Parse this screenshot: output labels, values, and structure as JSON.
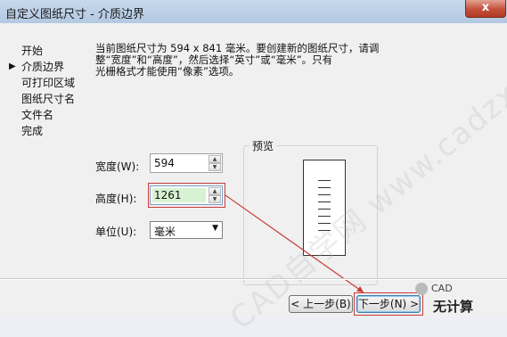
{
  "window": {
    "title": "自定义图纸尺寸 - 介质边界",
    "close_glyph": "x"
  },
  "nav": {
    "items": [
      {
        "label": "开始",
        "active": false
      },
      {
        "label": "介质边界",
        "active": true
      },
      {
        "label": "可打印区域",
        "active": false
      },
      {
        "label": "图纸尺寸名",
        "active": false
      },
      {
        "label": "文件名",
        "active": false
      },
      {
        "label": "完成",
        "active": false
      }
    ]
  },
  "description": {
    "line1": "当前图纸尺寸为 594 x 841 毫米。要创建新的图纸尺寸，请调",
    "line2": "整“宽度”和“高度”，然后选择“英寸”或“毫米”。只有",
    "line3": "光栅格式才能使用“像素”选项。"
  },
  "width": {
    "label": "宽度(W):",
    "value": "594"
  },
  "height": {
    "label": "高度(H):",
    "value": "1261"
  },
  "units": {
    "label": "单位(U):",
    "value": "毫米"
  },
  "preview": {
    "title": "预览"
  },
  "buttons": {
    "back": "< 上一步(B)",
    "next": "下一步(N) >"
  },
  "watermark": {
    "text": "CAD自学网 www.cadzxw.com"
  },
  "branding": {
    "caption": "CAD",
    "name": "无计算"
  },
  "colors": {
    "highlight_box": "#c93a3a",
    "selected_value": "#d7f2d2"
  }
}
